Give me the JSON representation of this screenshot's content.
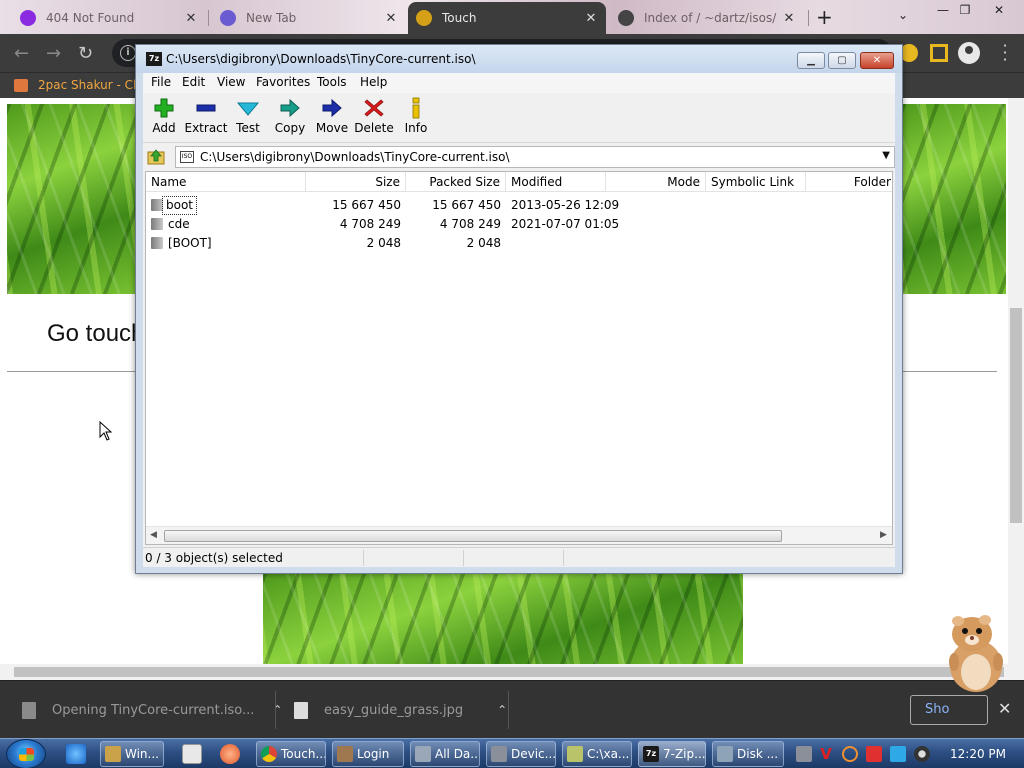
{
  "browser": {
    "tabs": [
      {
        "title": "404 Not Found",
        "favicon_color": "#8a2be2"
      },
      {
        "title": "New Tab",
        "favicon_color": "#6b5bd2"
      },
      {
        "title": "Touch",
        "favicon_color": "#d4a017"
      },
      {
        "title": "Index of / ~dartz/isos/",
        "favicon_color": "#444444"
      }
    ],
    "new_tab_icon": "plus-icon",
    "bookmark": {
      "label": "2pac Shakur - Chro"
    },
    "page": {
      "heading": "Go touch"
    },
    "downloads": [
      {
        "label": "Opening TinyCore-current.iso..."
      },
      {
        "label": "easy_guide_grass.jpg"
      }
    ],
    "show_all_label": "Sho"
  },
  "zip": {
    "title": "C:\\Users\\digibrony\\Downloads\\TinyCore-current.iso\\",
    "app_icon_text": "7z",
    "menu": [
      "File",
      "Edit",
      "View",
      "Favorites",
      "Tools",
      "Help"
    ],
    "toolbar": [
      {
        "label": "Add",
        "icon": "plus-icon",
        "color": "#22b022"
      },
      {
        "label": "Extract",
        "icon": "minus-icon",
        "color": "#1c2fa8"
      },
      {
        "label": "Test",
        "icon": "check-icon",
        "color": "#1ba8c8"
      },
      {
        "label": "Copy",
        "icon": "copy-arrow-icon",
        "color": "#179e88"
      },
      {
        "label": "Move",
        "icon": "move-arrow-icon",
        "color": "#1c2fa8"
      },
      {
        "label": "Delete",
        "icon": "delete-x-icon",
        "color": "#d81c1c"
      },
      {
        "label": "Info",
        "icon": "info-icon",
        "color": "#d4b000"
      }
    ],
    "address": "C:\\Users\\digibrony\\Downloads\\TinyCore-current.iso\\",
    "columns": [
      "Name",
      "Size",
      "Packed Size",
      "Modified",
      "Mode",
      "Symbolic Link",
      "Folder"
    ],
    "rows": [
      {
        "name": "boot",
        "size": "15 667 450",
        "packed": "15 667 450",
        "modified": "2013-05-26 12:09"
      },
      {
        "name": "cde",
        "size": "4 708 249",
        "packed": "4 708 249",
        "modified": "2021-07-07 01:05"
      },
      {
        "name": "[BOOT]",
        "size": "2 048",
        "packed": "2 048",
        "modified": ""
      }
    ],
    "status": "0 / 3 object(s) selected"
  },
  "taskbar": {
    "buttons": [
      {
        "label": "Win...",
        "color": "#c9a24a"
      },
      {
        "label": "Touch...",
        "color": "#e04b3a"
      },
      {
        "label": "Login",
        "color": "#a07850"
      },
      {
        "label": "All Da...",
        "color": "#9aa7b8"
      },
      {
        "label": "Devic...",
        "color": "#8a8f99"
      },
      {
        "label": "C:\\xa...",
        "color": "#b9c46a"
      },
      {
        "label": "7-Zip...",
        "color": "#1a1a1a"
      },
      {
        "label": "Disk ...",
        "color": "#8fa3b8"
      }
    ],
    "clock": "12:20 PM"
  }
}
